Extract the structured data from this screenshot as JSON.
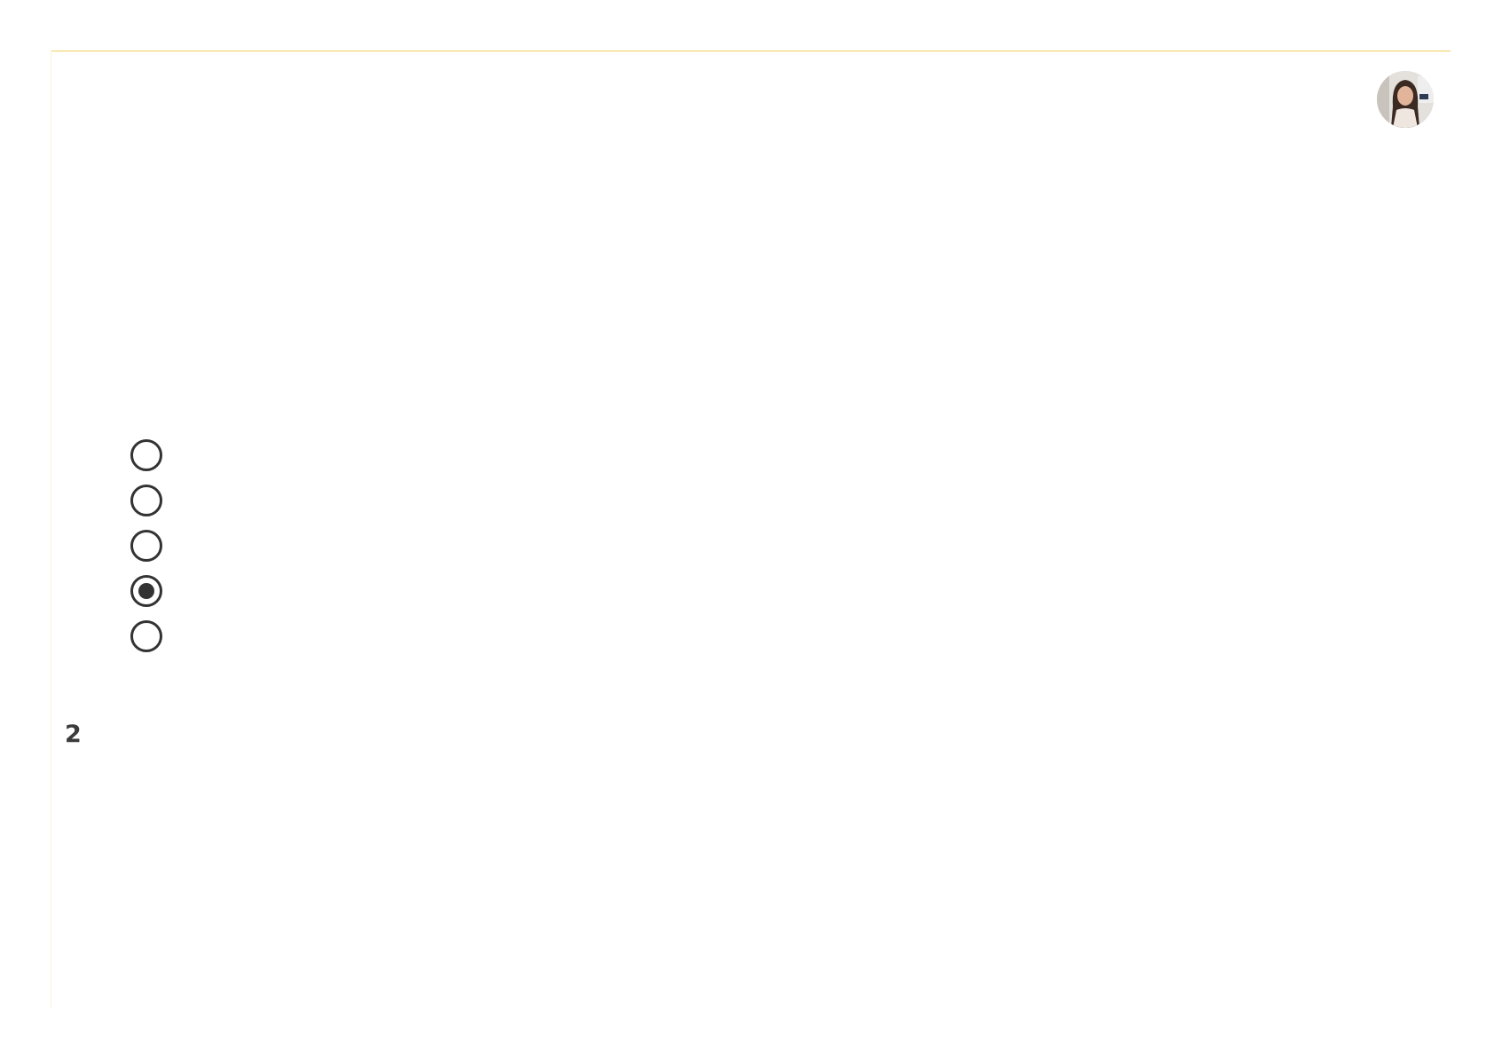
{
  "question": {
    "number": "2"
  },
  "radio_options": [
    {
      "checked": false
    },
    {
      "checked": false
    },
    {
      "checked": false
    },
    {
      "checked": true
    },
    {
      "checked": false
    }
  ],
  "avatar": {
    "icon": "user-avatar-photo"
  },
  "colors": {
    "accent": "#f2cf5a",
    "radio": "#333333",
    "text": "#3b3b3b"
  }
}
